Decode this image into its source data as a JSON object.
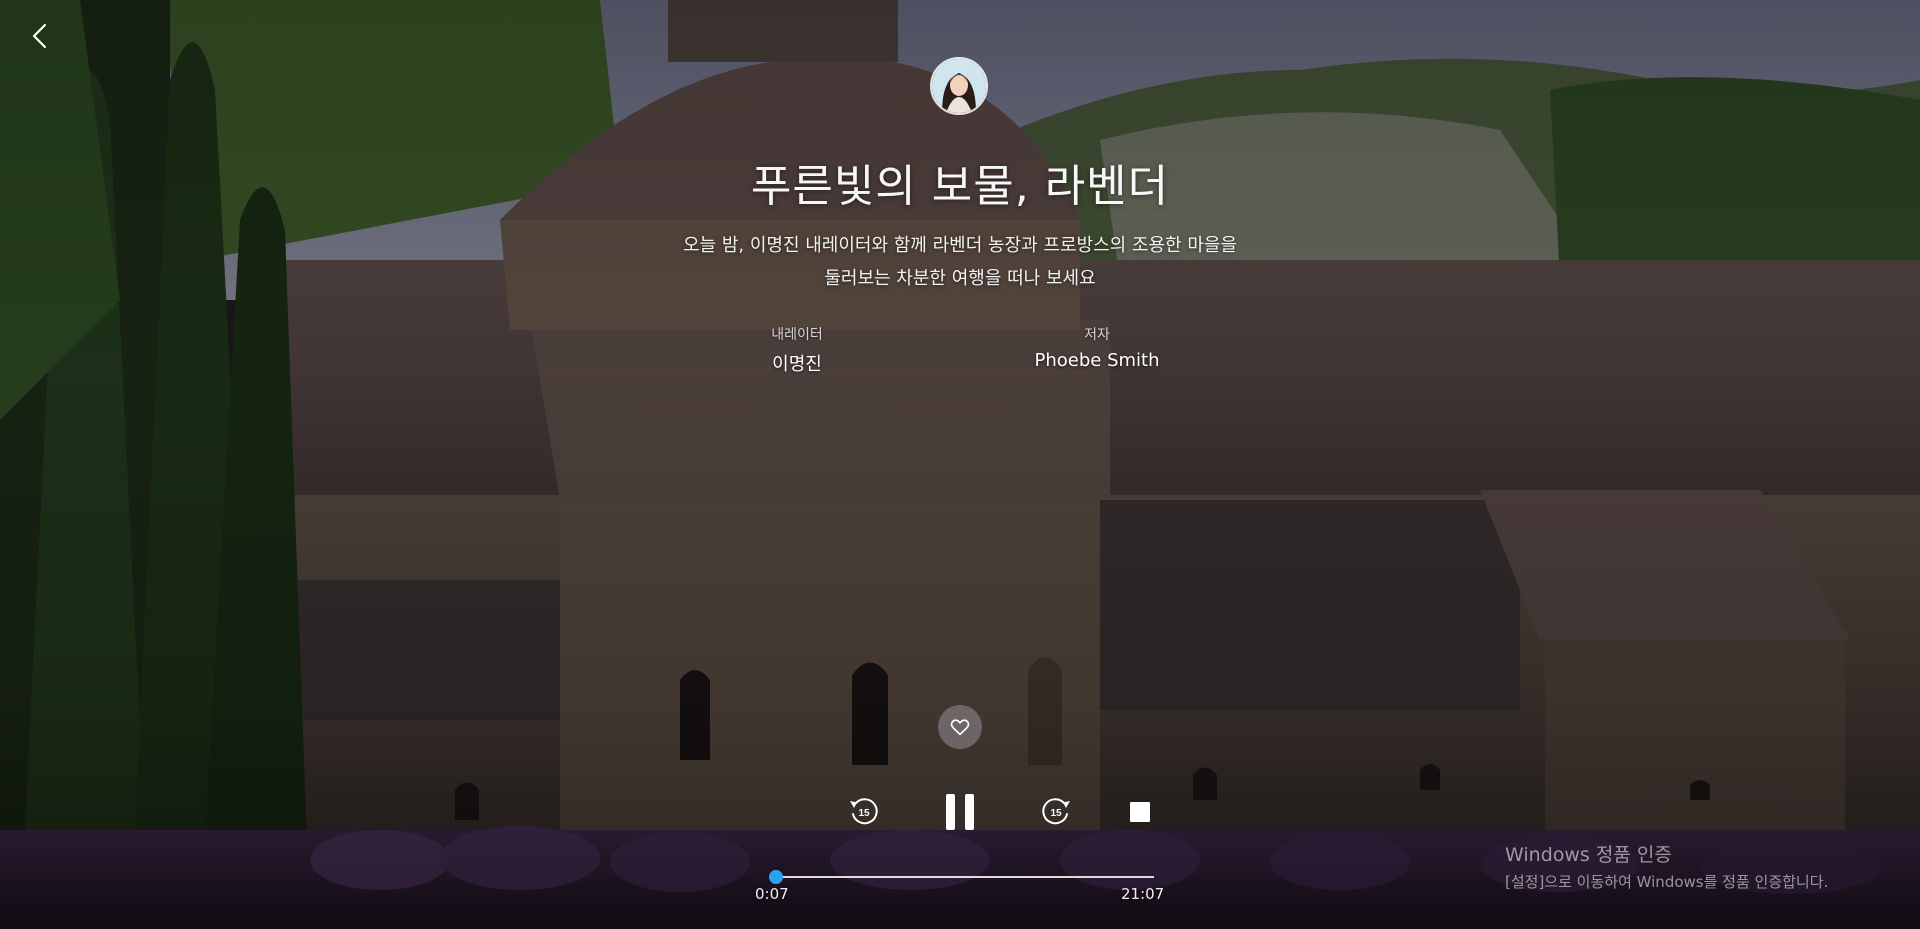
{
  "episode": {
    "title": "푸른빛의 보물, 라벤더",
    "description_lines": [
      "오늘 밤, 이명진 내레이터와 함께 라벤더 농장과 프로방스의 조용한 마을을",
      "둘러보는 차분한 여행을 떠나 보세요"
    ]
  },
  "credits": {
    "narrator": {
      "label": "내레이터",
      "name": "이명진"
    },
    "author": {
      "label": "저자",
      "name": "Phoebe Smith"
    }
  },
  "player": {
    "elapsed": "0:07",
    "total": "21:07",
    "progress_fraction": 0.006,
    "skip_back_seconds": "15",
    "skip_forward_seconds": "15",
    "accent_color": "#2aa3ef"
  },
  "icons": {
    "back": "chevron-left-icon",
    "like": "heart-outline-icon",
    "rewind": "rewind-15-icon",
    "pause": "pause-icon",
    "forward": "forward-15-icon",
    "stop": "stop-icon"
  },
  "system_watermark": {
    "title": "Windows 정품 인증",
    "subtitle": "[설정]으로 이동하여 Windows를 정품 인증합니다."
  }
}
